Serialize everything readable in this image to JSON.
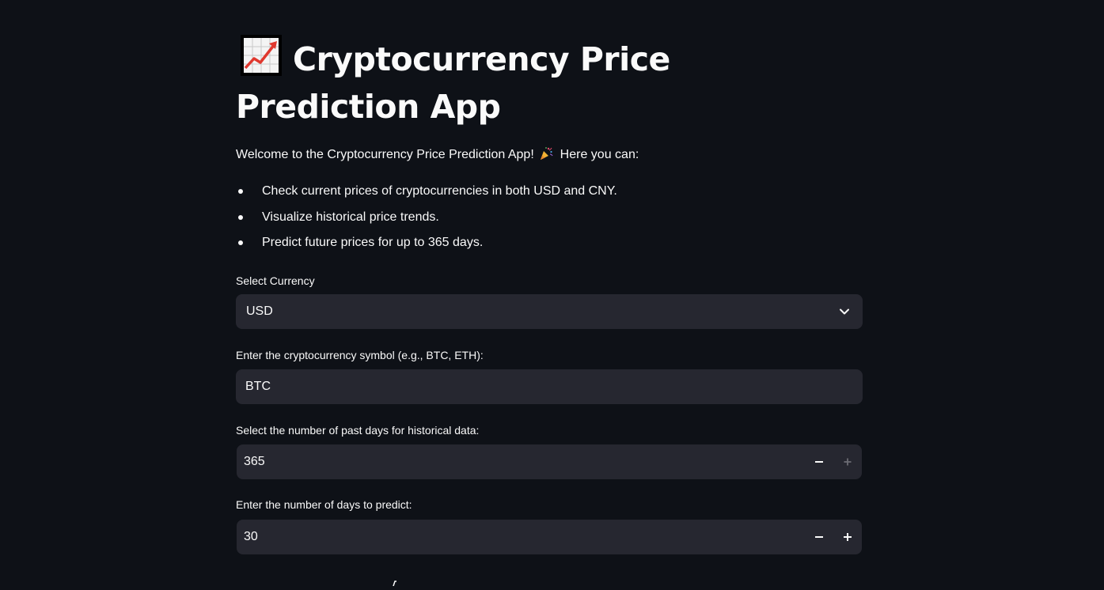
{
  "header": {
    "title": "Cryptocurrency Price Prediction App",
    "title_icon": "chart-increasing-icon"
  },
  "intro": {
    "welcome_before": "Welcome to the Cryptocurrency Price Prediction App!",
    "welcome_icon": "party-popper-icon",
    "welcome_after": "Here you can:",
    "bullets": [
      "Check current prices of cryptocurrencies in both USD and CNY.",
      "Visualize historical price trends.",
      "Predict future prices for up to 365 days."
    ]
  },
  "form": {
    "currency": {
      "label": "Select Currency",
      "selected": "USD"
    },
    "symbol": {
      "label": "Enter the cryptocurrency symbol (e.g., BTC, ETH):",
      "value": "BTC"
    },
    "past_days": {
      "label": "Select the number of past days for historical data:",
      "value": "365",
      "plus_disabled": true
    },
    "predict_days": {
      "label": "Enter the number of days to predict:",
      "value": "30",
      "plus_disabled": false
    }
  },
  "colors": {
    "background": "#0e1117",
    "input_bg": "#262730",
    "text": "#fafafa",
    "disabled": "#6b6c73",
    "chart_red": "#e0382e"
  }
}
